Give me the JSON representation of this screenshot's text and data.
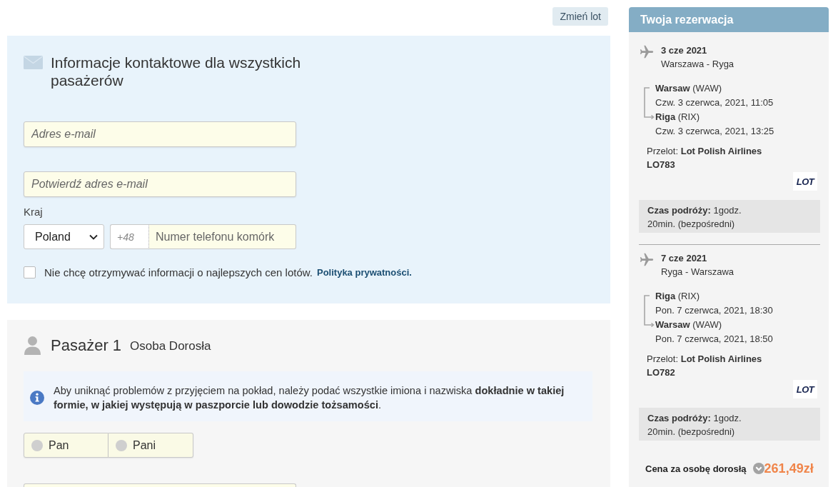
{
  "top_bar": {
    "change_flight_button": "Zmień lot"
  },
  "contact": {
    "title": "Informacje kontaktowe dla wszystkich pasażerów",
    "email_field": {
      "placeholder": "Adres e-mail"
    },
    "email_confirm_field": {
      "placeholder": "Potwierdź adres e-mail"
    },
    "country_label": "Kraj",
    "country_select": {
      "value": "Poland"
    },
    "phone_prefix": "+48",
    "phone_field": {
      "placeholder": "Numer telefonu komórk"
    },
    "newsletter_opt_out": {
      "label": "Nie chcę otrzymywać informacji o najlepszych cen lotów.",
      "checked": false
    },
    "privacy_link": "Polityka prywatności."
  },
  "passenger": {
    "title": "Pasażer 1",
    "type": "Osoba Dorosła",
    "notice": "Aby uniknąć problemów z przyjęciem na pokład, należy podać wszystkie imiona i nazwiska **dokładnie w takiej formie, w jakiej występują w paszporcie lub dowodzie tożsamości**.",
    "salutations": [
      {
        "label": "Pan",
        "selected": false
      },
      {
        "label": "Pani",
        "selected": false
      }
    ]
  },
  "booking": {
    "title": "Twoja rezerwacja",
    "flights": [
      {
        "date": "3 cze 2021",
        "route": "Warszawa - Ryga",
        "legs": [
          {
            "place": "**Warsaw** (WAW)",
            "time": "Czw. 3 czerwca, 2021, 11:05"
          },
          {
            "place": "**Riga** (RIX)",
            "time": "Czw. 3 czerwca, 2021, 13:25"
          }
        ],
        "carrier": "Przelot: **Lot Polish Airlines**",
        "flight_number": "LO783",
        "airline_logo": "LOT",
        "duration": "**Czas podróży:** 1godz. 20min. (bezpośredni)"
      },
      {
        "date": "7 cze 2021",
        "route": "Ryga - Warszawa",
        "legs": [
          {
            "place": "**Riga** (RIX)",
            "time": "Pon. 7 czerwca, 2021, 18:30"
          },
          {
            "place": "**Warsaw** (WAW)",
            "time": "Pon. 7 czerwca, 2021, 18:50"
          }
        ],
        "carrier": "Przelot: **Lot Polish Airlines**",
        "flight_number": "LO782",
        "airline_logo": "LOT",
        "duration": "**Czas podróży:** 1godz. 20min. (bezpośredni)"
      }
    ],
    "price_label": "Cena za osobę dorosłą",
    "price": "261,49zł"
  }
}
